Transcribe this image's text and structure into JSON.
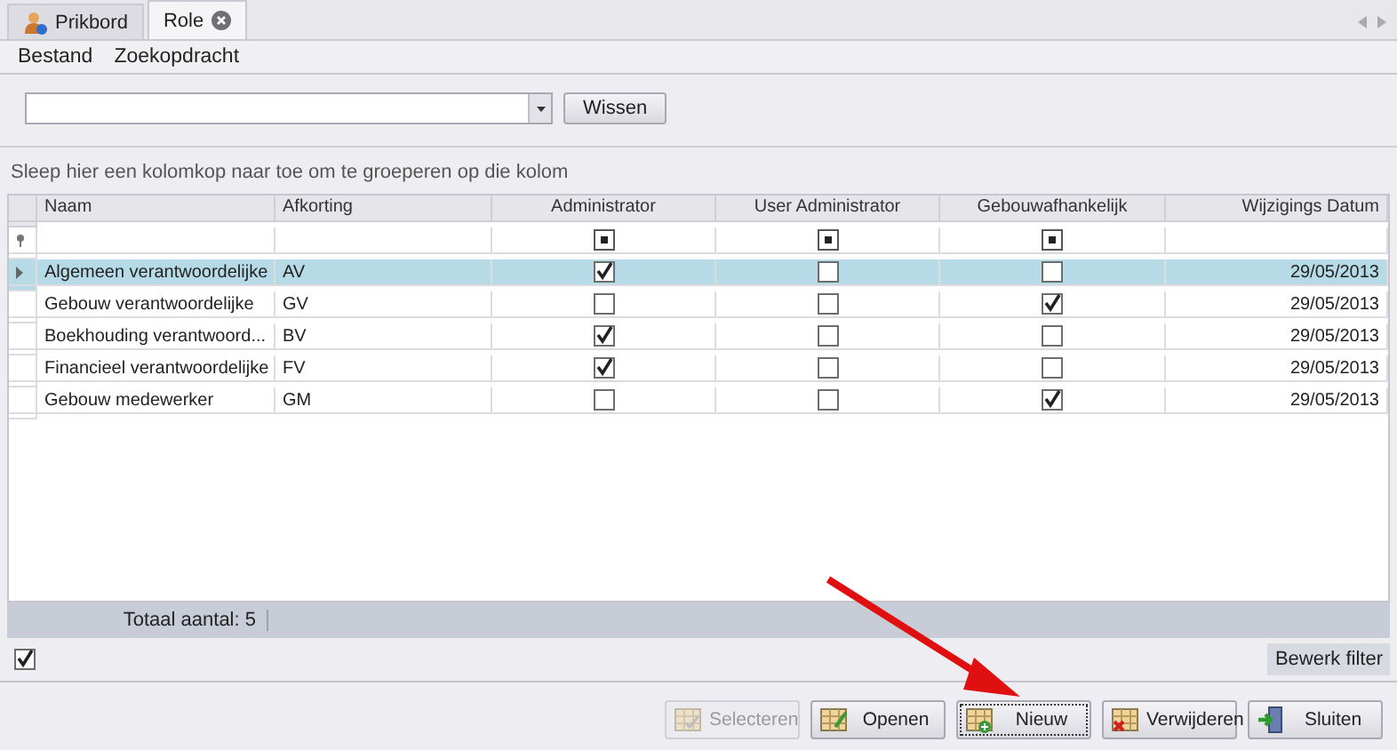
{
  "tabs": [
    {
      "label": "Prikbord",
      "selected": false,
      "closable": false
    },
    {
      "label": "Role",
      "selected": true,
      "closable": true
    }
  ],
  "menu": [
    "Bestand",
    "Zoekopdracht"
  ],
  "search": {
    "button": "Wissen"
  },
  "group_panel": {
    "hint": "Sleep hier een kolomkop naar toe om te groeperen op die kolom"
  },
  "table": {
    "columns": [
      {
        "label": "Naam",
        "kind": "text"
      },
      {
        "label": "Afkorting",
        "kind": "text"
      },
      {
        "label": "Administrator",
        "kind": "check",
        "filter_indeterminate": true
      },
      {
        "label": "User Administrator",
        "kind": "check",
        "filter_indeterminate": true
      },
      {
        "label": "Gebouwafhankelijk",
        "kind": "check",
        "filter_indeterminate": true
      },
      {
        "label": "Wijzigings Datum",
        "kind": "date"
      }
    ],
    "rows": [
      {
        "selected": true,
        "cells": [
          "Algemeen verantwoordelijke",
          "AV",
          true,
          false,
          false,
          "29/05/2013"
        ]
      },
      {
        "selected": false,
        "cells": [
          "Gebouw verantwoordelijke",
          "GV",
          false,
          false,
          true,
          "29/05/2013"
        ]
      },
      {
        "selected": false,
        "cells": [
          "Boekhouding verantwoord...",
          "BV",
          true,
          false,
          false,
          "29/05/2013"
        ]
      },
      {
        "selected": false,
        "cells": [
          "Financieel verantwoordelijke",
          "FV",
          true,
          false,
          false,
          "29/05/2013"
        ]
      },
      {
        "selected": false,
        "cells": [
          "Gebouw medewerker",
          "GM",
          false,
          false,
          true,
          "29/05/2013"
        ]
      }
    ]
  },
  "footer": {
    "total": "Totaal aantal: 5"
  },
  "filter_bar": {
    "checked": true,
    "button": "Bewerk filter"
  },
  "buttons": [
    {
      "label": "Selecteren",
      "disabled": true,
      "focused": false
    },
    {
      "label": "Openen",
      "disabled": false,
      "focused": false
    },
    {
      "label": "Nieuw",
      "disabled": false,
      "focused": true
    },
    {
      "label": "Verwijderen",
      "disabled": false,
      "focused": false
    },
    {
      "label": "Sluiten",
      "disabled": false,
      "focused": false
    }
  ]
}
